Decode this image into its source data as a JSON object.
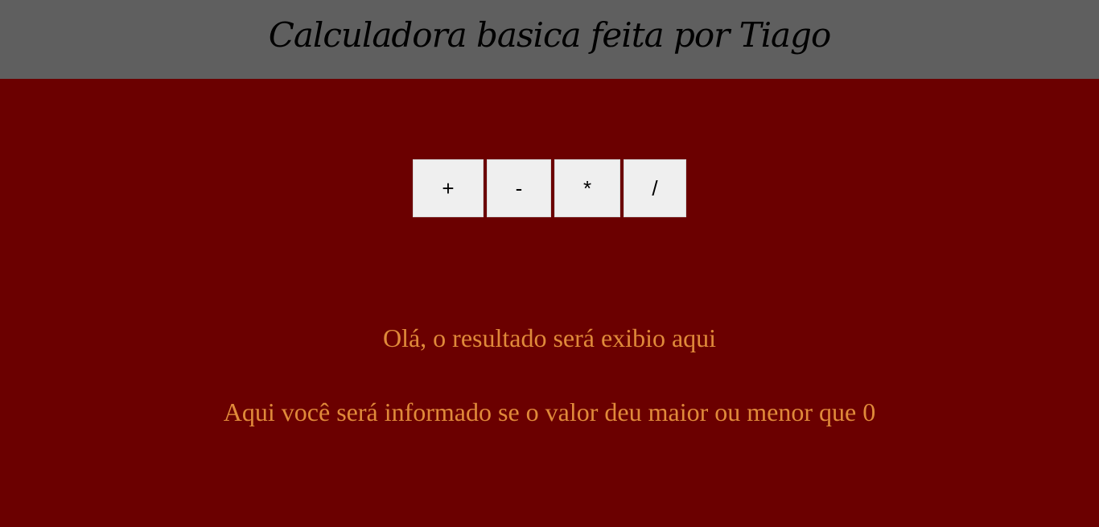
{
  "header": {
    "title": "Calculadora basica feita por Tiago"
  },
  "operations": {
    "add_label": "+",
    "sub_label": "-",
    "mul_label": "*",
    "div_label": "/"
  },
  "output": {
    "result_text": "Olá, o resultado será exibio aqui",
    "info_text": "Aqui você será informado se o valor deu maior ou menor que 0"
  },
  "colors": {
    "header_bg": "#5f5f5f",
    "main_bg": "#6b0000",
    "button_bg": "#efefef",
    "output_text": "#e08a3a"
  }
}
